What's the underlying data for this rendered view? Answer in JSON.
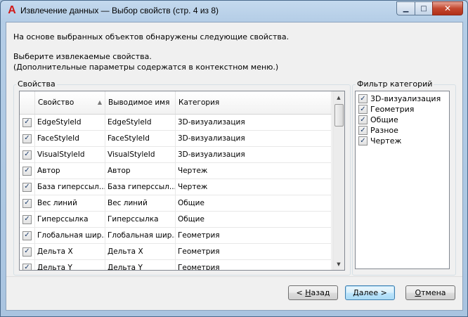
{
  "window": {
    "title": "Извлечение данных — Выбор свойств (стр. 4 из 8)",
    "app_icon_letter": "A"
  },
  "intro": {
    "line1": "На основе выбранных объектов обнаружены следующие свойства.",
    "line2": "Выберите извлекаемые свойства.",
    "line3": "(Дополнительные параметры содержатся в контекстном меню.)"
  },
  "properties": {
    "group_label": "Свойства",
    "columns": [
      "",
      "Свойство",
      "Выводимое имя",
      "Категория"
    ],
    "rows": [
      {
        "checked": true,
        "property": "EdgeStyleId",
        "display": "EdgeStyleId",
        "category": "3D-визуализация"
      },
      {
        "checked": true,
        "property": "FaceStyleId",
        "display": "FaceStyleId",
        "category": "3D-визуализация"
      },
      {
        "checked": true,
        "property": "VisualStyleId",
        "display": "VisualStyleId",
        "category": "3D-визуализация"
      },
      {
        "checked": true,
        "property": "Автор",
        "display": "Автор",
        "category": "Чертеж"
      },
      {
        "checked": true,
        "property": "База гиперссыл...",
        "display": "База гиперссыл...",
        "category": "Чертеж"
      },
      {
        "checked": true,
        "property": "Вес линий",
        "display": "Вес линий",
        "category": "Общие"
      },
      {
        "checked": true,
        "property": "Гиперссылка",
        "display": "Гиперссылка",
        "category": "Общие"
      },
      {
        "checked": true,
        "property": "Глобальная шир...",
        "display": "Глобальная шир...",
        "category": "Геометрия"
      },
      {
        "checked": true,
        "property": "Дельта X",
        "display": "Дельта X",
        "category": "Геометрия"
      },
      {
        "checked": true,
        "property": "Дельта Y",
        "display": "Дельта Y",
        "category": "Геометрия"
      }
    ]
  },
  "filter": {
    "group_label": "Фильтр категорий",
    "items": [
      {
        "label": "3D-визуализация",
        "checked": true
      },
      {
        "label": "Геометрия",
        "checked": true
      },
      {
        "label": "Общие",
        "checked": true
      },
      {
        "label": "Разное",
        "checked": true
      },
      {
        "label": "Чертеж",
        "checked": true
      }
    ]
  },
  "buttons": {
    "back": "< Назад",
    "next": "Далее >",
    "cancel": "Отмена"
  }
}
